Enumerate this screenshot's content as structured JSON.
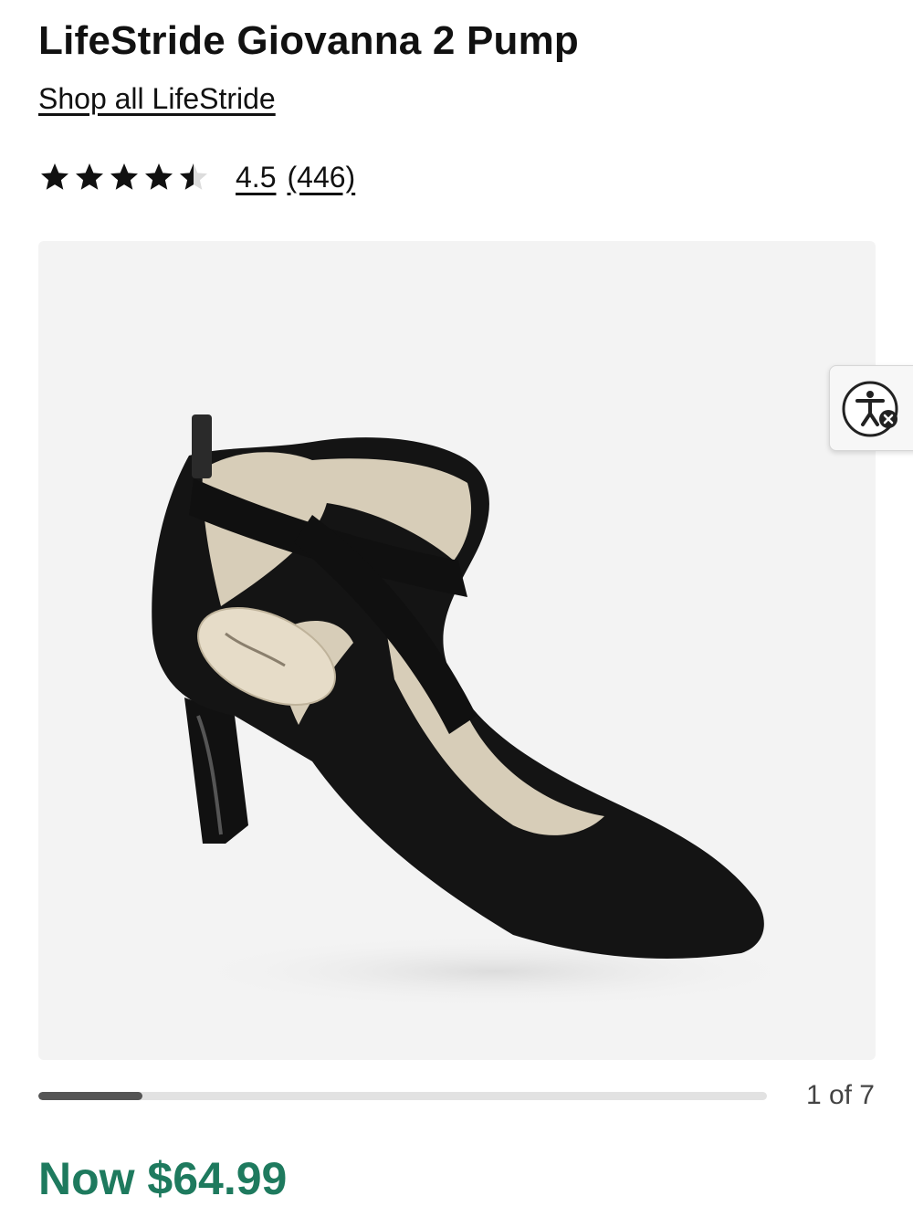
{
  "product": {
    "title": "LifeStride Giovanna 2 Pump",
    "brand_link": "Shop all LifeStride"
  },
  "rating": {
    "value": 4.5,
    "value_text": "4.5",
    "count_text": "(446)",
    "max_stars": 5,
    "star_color": "#111111"
  },
  "gallery": {
    "image_icon": "black-suede-pump-photo",
    "counter_text": "1 of 7",
    "current": 1,
    "total": 7,
    "progress_fraction": 0.143
  },
  "accessibility": {
    "icon": "accessibility-icon"
  },
  "price": {
    "text": "Now $64.99",
    "color": "#1e7a5e"
  }
}
